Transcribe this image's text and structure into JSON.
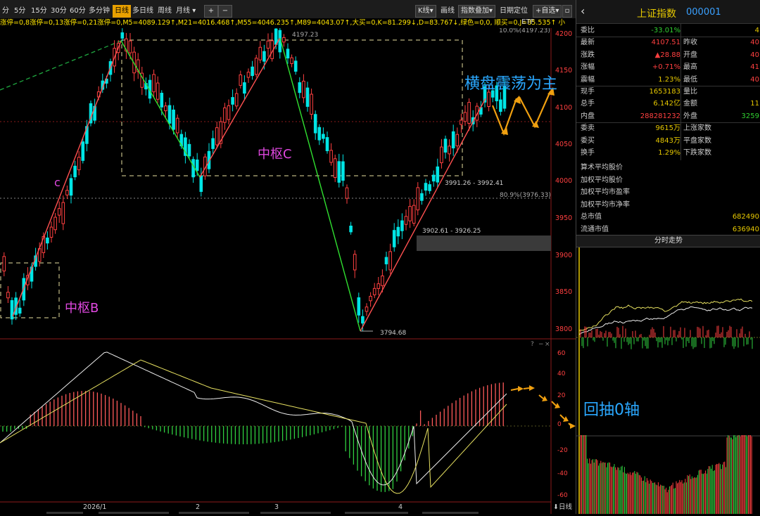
{
  "toolbar": {
    "periods": [
      "分",
      "5分",
      "15分",
      "30分",
      "60分",
      "多分钟",
      "日线",
      "多日线",
      "周线",
      "月线"
    ],
    "active_period": "日线",
    "month_dropdown": "月线",
    "plus": "+",
    "minus": "−",
    "kline": "K线",
    "draw": "画线",
    "overlay": "指数叠加",
    "date_locate": "日期定位",
    "add_watch": "+自选"
  },
  "indicators_row": "涨停=0,8涨停=0,13涨停=0,21涨停=0,M5=4089.129↑,M21=4016.468↑,M55=4046.235↑,M89=4043.07↑,大买=0,K=81.299↓,D=83.767↓,绿色=0,0,  顺买=0,J=85.535↑ 小",
  "etf_label": "ETF",
  "price_axis": {
    "labels": [
      "4200",
      "4150",
      "4100",
      "4050",
      "4000",
      "3950",
      "3900",
      "3850",
      "3800"
    ],
    "pct_top": "10.0%(4197.23)",
    "pct_mid": "80.9%(3976.33)"
  },
  "macd_axis": {
    "labels": [
      "60",
      "40",
      "20",
      "0",
      "-20",
      "-40",
      "-60"
    ]
  },
  "date_axis": {
    "labels": [
      "2026/1",
      "2",
      "3",
      "4"
    ],
    "bottom_right": "⬇日线"
  },
  "annotations": {
    "zhongshu_b": "中枢B",
    "zhongshu_c": "中枢C",
    "c_label": "c",
    "sideways": "横盘震荡为主",
    "pullback": "回抽0轴",
    "high_label": "4197.23",
    "low_label": "3794.68",
    "range_1": "3991.26 - 3992.41",
    "range_2": "3902.61 - 3926.25"
  },
  "right_panel": {
    "title": "上证指数",
    "code": "000001",
    "rows": [
      {
        "label": "委比",
        "value": "-33.01%",
        "label2": "",
        "value2": "4"
      },
      {
        "label": "最新",
        "value": "4107.51",
        "label2": "昨收",
        "value2": "40"
      },
      {
        "label": "涨跌",
        "value": "▲28.88",
        "label2": "开盘",
        "value2": "40"
      },
      {
        "label": "涨幅",
        "value": "+0.71%",
        "label2": "最高",
        "value2": "41"
      },
      {
        "label": "震幅",
        "value": "1.23%",
        "label2": "最低",
        "value2": "40"
      },
      {
        "label": "现手",
        "value": "1653183",
        "label2": "量比",
        "value2": ""
      },
      {
        "label": "总手",
        "value": "6.142亿",
        "label2": "金额",
        "value2": "11"
      },
      {
        "label": "内盘",
        "value": "288281232",
        "label2": "外盘",
        "value2": "3259"
      },
      {
        "label": "委卖",
        "value": "9615万",
        "label2": "上涨家数",
        "value2": ""
      },
      {
        "label": "委买",
        "value": "4843万",
        "label2": "平盘家数",
        "value2": ""
      },
      {
        "label": "换手",
        "value": "1.29%",
        "label2": "下跌家数",
        "value2": ""
      }
    ],
    "extra": [
      {
        "label": "算术平均股价",
        "value": ""
      },
      {
        "label": "加权平均股价",
        "value": ""
      },
      {
        "label": "加权平均市盈率",
        "value": ""
      },
      {
        "label": "加权平均市净率",
        "value": ""
      },
      {
        "label": "总市值",
        "value": "682490"
      },
      {
        "label": "流通市值",
        "value": "636940"
      }
    ],
    "intraday_title": "分时走势"
  }
}
